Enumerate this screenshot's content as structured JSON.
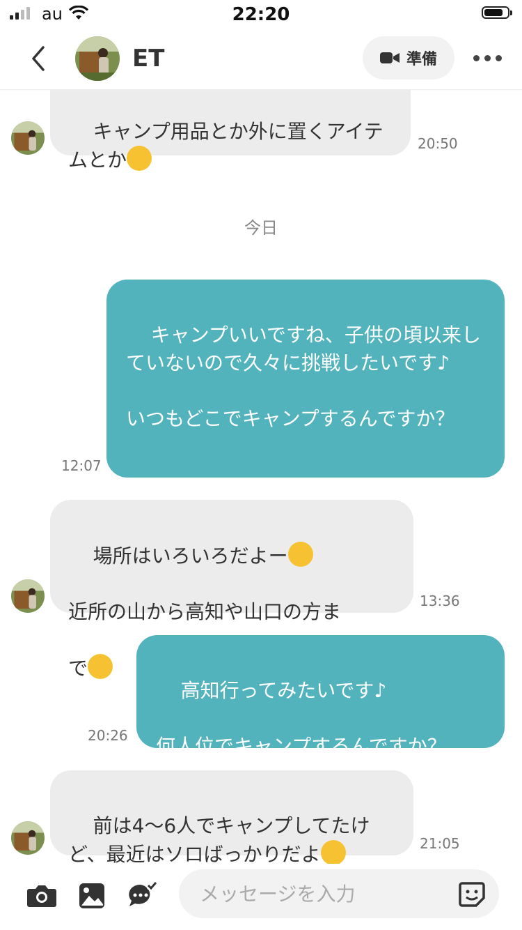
{
  "status_bar": {
    "carrier": "au",
    "time": "22:20"
  },
  "header": {
    "name": "ET",
    "video_label": "準備"
  },
  "messages": {
    "m1_text": "キャンプ用品とか外に置くアイテムとか",
    "m1_time": "20:50",
    "day_separator": "今日",
    "m2_text": "キャンプいいですね、子供の頃以来していないので久々に挑戦したいです♪\n\nいつもどこでキャンプするんですか？",
    "m2_time": "12:07",
    "m3_line1": "場所はいろいろだよー",
    "m3_line2": "近所の山から高知や山口の方ま",
    "m3_line3": "で",
    "m3_time": "13:36",
    "m4_text": "高知行ってみたいです♪\n\n何人位でキャンプするんですか？",
    "m4_time": "20:26",
    "m5_text": "前は4〜6人でキャンプしてたけど、最近はソロばっかりだよ",
    "m5_time": "21:05"
  },
  "input": {
    "placeholder": "メッセージを入力"
  },
  "colors": {
    "outgoing_bubble": "#52b3bd",
    "incoming_bubble": "#ececec"
  },
  "icons": [
    "back-chevron-icon",
    "video-camera-icon",
    "more-dots-icon",
    "camera-icon",
    "image-icon",
    "chat-check-icon",
    "sticker-icon"
  ]
}
